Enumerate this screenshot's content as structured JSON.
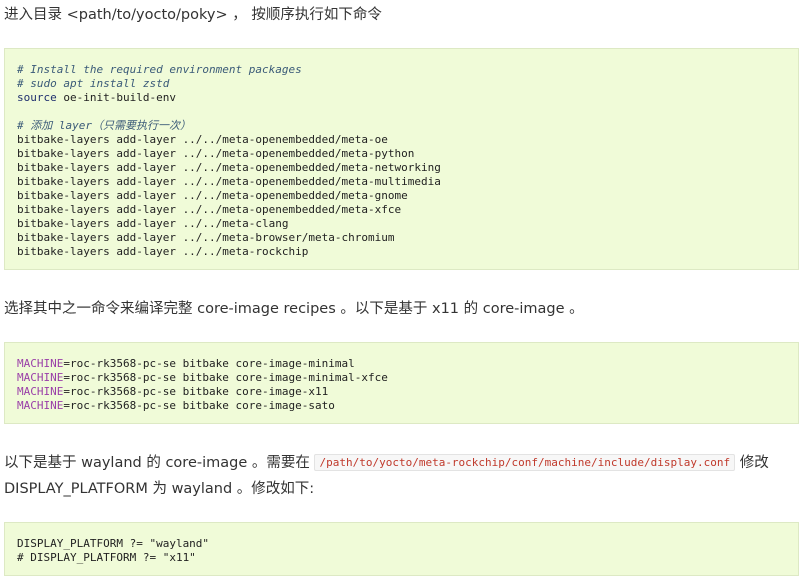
{
  "para1": {
    "text": "进入目录 <path/to/yocto/poky> ， 按顺序执行如下命令"
  },
  "code1": {
    "comment1": "# Install the required environment packages",
    "comment2": "# sudo apt install zstd",
    "source_kw": "source",
    "source_arg": " oe-init-build-env",
    "comment3": "# 添加 layer（只需要执行一次）",
    "lines": [
      "bitbake-layers add-layer ../../meta-openembedded/meta-oe",
      "bitbake-layers add-layer ../../meta-openembedded/meta-python",
      "bitbake-layers add-layer ../../meta-openembedded/meta-networking",
      "bitbake-layers add-layer ../../meta-openembedded/meta-multimedia",
      "bitbake-layers add-layer ../../meta-openembedded/meta-gnome",
      "bitbake-layers add-layer ../../meta-openembedded/meta-xfce",
      "bitbake-layers add-layer ../../meta-clang",
      "bitbake-layers add-layer ../../meta-browser/meta-chromium",
      "bitbake-layers add-layer ../../meta-rockchip"
    ]
  },
  "para2": {
    "text": "选择其中之一命令来编译完整 core-image recipes 。以下是基于 x11 的 core-image 。"
  },
  "code2": {
    "var": "MACHINE",
    "lines": [
      "=roc-rk3568-pc-se bitbake core-image-minimal",
      "=roc-rk3568-pc-se bitbake core-image-minimal-xfce",
      "=roc-rk3568-pc-se bitbake core-image-x11",
      "=roc-rk3568-pc-se bitbake core-image-sato"
    ]
  },
  "para3": {
    "before": "以下是基于 wayland 的 core-image 。需要在 ",
    "inline_code": "/path/to/yocto/meta-rockchip/conf/machine/include/display.conf",
    "after": " 修改",
    "line2": "DISPLAY_PLATFORM 为 wayland 。修改如下:"
  },
  "code3": {
    "lines": [
      "DISPLAY_PLATFORM ?= \"wayland\"",
      "# DISPLAY_PLATFORM ?= \"x11\""
    ]
  },
  "colors": {
    "code_bg": "#f0fbd8",
    "code_border": "#dde9c4",
    "comment": "#3a5a78",
    "variable": "#9a3fa8",
    "inline_code_text": "#c0392b"
  }
}
